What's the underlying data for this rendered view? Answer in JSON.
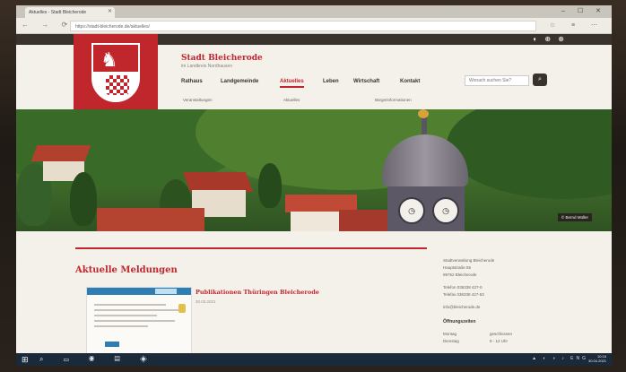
{
  "browser": {
    "tab_title": "Aktuelles - Stadt Bleicherode",
    "url": "https://stadt-bleicherode.de/aktuelles/",
    "window_controls": "– ☐ ✕",
    "nav_buttons": "← → ⟳",
    "icons": "☆ ≡ ⋯"
  },
  "site": {
    "town_name": "Stadt Bleicherode",
    "town_subtitle": "im Landkreis Nordhausen",
    "search_placeholder": "Wonach suchen Sie?",
    "nav": [
      "Rathaus",
      "Landgemeinde",
      "Aktuelles",
      "Leben",
      "Wirtschaft",
      "Kontakt"
    ],
    "active_nav": "Aktuelles",
    "subnav": [
      "Veranstaltungen",
      "Aktuelles",
      "Bürgerinformationen"
    ],
    "hero_caption": "© Bernd Müller",
    "section_title": "Aktuelle Meldungen",
    "news": [
      {
        "title": "Publikationen Thüringen Bleicherode",
        "date": "30.03.2021"
      }
    ],
    "sidebar": {
      "address_lines": [
        "Stadtverwaltung Bleicherode",
        "Hauptstraße 55",
        "99752 Bleicherode",
        "",
        "Telefon 036338 427-0",
        "Telefax 036338 427-53",
        "",
        "info@bleicherode.de"
      ],
      "hours_heading": "Öffnungszeiten",
      "hours": [
        [
          "Montag",
          "geschlossen"
        ],
        [
          "Dienstag",
          "9 - 12 Uhr"
        ]
      ]
    }
  },
  "taskbar": {
    "start_icon": "windows-icon",
    "time": "10:16",
    "date": "30.04.2021",
    "tray": "▲ ◐ ◑ ♪ ENG"
  },
  "colors": {
    "brand_red": "#c0272d",
    "dark": "#3a332d"
  }
}
